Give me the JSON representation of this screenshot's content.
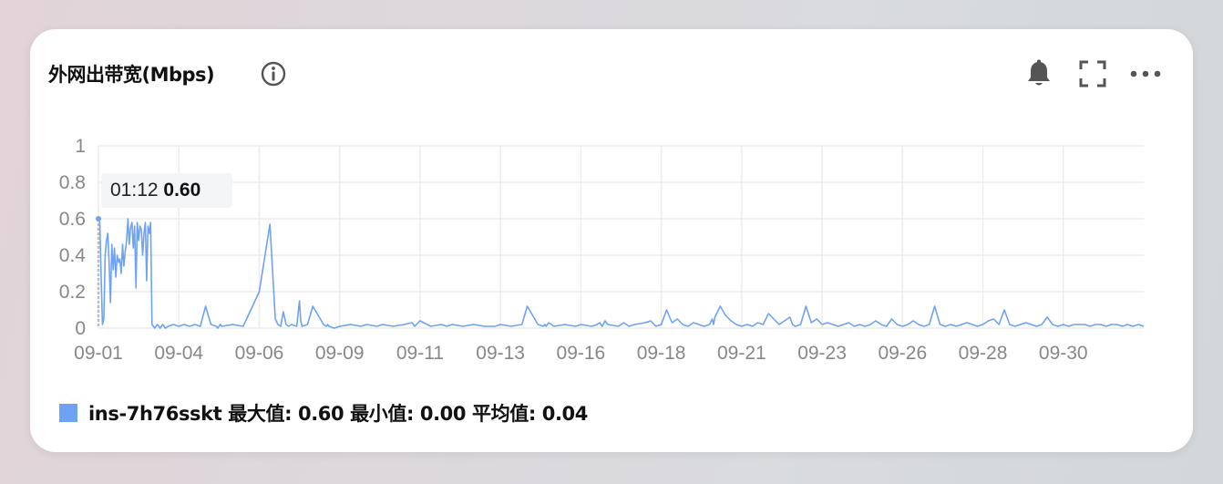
{
  "panel": {
    "title": "外网出带宽(Mbps)"
  },
  "icons": {
    "info": "info-circle-icon",
    "bell": "bell-icon",
    "fullscreen": "fullscreen-icon",
    "more": "more-icon"
  },
  "tooltip": {
    "time": "01:12",
    "value": "0.60"
  },
  "legend": {
    "name": "ins-7h76sskt",
    "max_label": "最大值:",
    "max": "0.60",
    "min_label": "最小值:",
    "min": "0.00",
    "avg_label": "平均值:",
    "avg": "0.04",
    "color": "#6ea3f4"
  },
  "chart_data": {
    "type": "line",
    "title": "外网出带宽(Mbps)",
    "xlabel": "",
    "ylabel": "",
    "ylim": [
      0,
      1
    ],
    "y_ticks": [
      "1",
      "0.8",
      "0.6",
      "0.4",
      "0.2",
      "0"
    ],
    "x_ticks": [
      "09-01",
      "09-04",
      "09-06",
      "09-09",
      "09-11",
      "09-13",
      "09-16",
      "09-18",
      "09-21",
      "09-23",
      "09-26",
      "09-28",
      "09-30"
    ],
    "grid": true,
    "legend_position": "bottom-left",
    "series": [
      {
        "name": "ins-7h76sskt",
        "color": "#6ea3f4",
        "x_days": [
          0.0,
          0.05,
          0.1,
          0.15,
          0.2,
          0.25,
          0.3,
          0.35,
          0.4,
          0.45,
          0.5,
          0.55,
          0.6,
          0.65,
          0.7,
          0.75,
          0.8,
          0.85,
          0.9,
          0.95,
          1.0,
          1.05,
          1.1,
          1.15,
          1.2,
          1.25,
          1.3,
          1.35,
          1.4,
          1.45,
          1.5,
          1.55,
          1.6,
          1.65,
          1.7,
          1.75,
          1.8,
          1.85,
          1.9,
          1.95,
          2.0,
          2.05,
          2.1,
          2.15,
          2.2,
          2.25,
          2.3,
          2.35,
          2.4,
          2.45,
          2.5,
          2.6,
          2.8,
          3.0,
          3.2,
          3.4,
          3.6,
          3.8,
          4.0,
          4.2,
          4.4,
          4.45,
          4.5,
          4.55,
          4.6,
          5.0,
          5.4,
          6.0,
          6.4,
          6.6,
          6.7,
          6.8,
          6.9,
          7.0,
          7.1,
          7.2,
          7.4,
          7.5,
          7.55,
          7.6,
          7.8,
          8.0,
          8.4,
          8.5,
          8.55,
          8.6,
          8.8,
          9.0,
          9.4,
          9.8,
          10.0,
          10.4,
          10.6,
          11.0,
          11.4,
          11.7,
          11.75,
          11.8,
          12.0,
          12.4,
          12.8,
          13.0,
          13.2,
          13.6,
          14.0,
          14.4,
          14.8,
          15.0,
          15.4,
          15.8,
          16.0,
          16.4,
          16.6,
          16.65,
          16.7,
          16.8,
          16.9,
          17.0,
          17.4,
          17.8,
          18.0,
          18.4,
          18.6,
          18.7,
          18.75,
          18.8,
          18.9,
          19.0,
          19.4,
          19.6,
          19.7,
          19.8,
          20.0,
          20.4,
          20.6,
          20.8,
          21.0,
          21.2,
          21.4,
          21.6,
          21.8,
          22.0,
          22.2,
          22.4,
          22.6,
          22.8,
          22.9,
          22.95,
          23.0,
          23.2,
          23.4,
          23.6,
          23.8,
          24.0,
          24.2,
          24.4,
          24.5,
          24.6,
          24.8,
          25.0,
          25.4,
          25.6,
          25.8,
          25.9,
          26.0,
          26.2,
          26.4,
          26.6,
          26.8,
          27.0,
          27.2,
          27.4,
          27.6,
          27.8,
          28.0,
          28.2,
          28.4,
          28.6,
          28.8,
          29.0,
          29.2,
          29.4,
          29.6,
          29.8,
          30.0,
          30.2,
          30.4,
          30.6,
          30.8,
          31.0,
          31.2,
          31.4,
          31.6,
          31.8,
          32.0,
          32.2,
          32.4,
          32.6,
          32.8,
          33.0,
          33.2,
          33.4,
          33.6,
          33.8,
          34.0,
          34.2,
          34.4,
          34.6,
          34.8,
          35.0,
          35.2,
          35.4,
          35.6,
          35.8,
          36.0,
          36.2,
          36.4,
          36.6,
          36.8,
          37.0,
          37.2,
          37.4,
          37.6,
          37.8,
          38.0,
          38.2,
          38.4,
          38.6,
          38.8,
          39.0
        ],
        "values": [
          0.6,
          0.58,
          0.3,
          0.02,
          0.05,
          0.4,
          0.48,
          0.52,
          0.35,
          0.14,
          0.46,
          0.32,
          0.44,
          0.28,
          0.4,
          0.36,
          0.38,
          0.3,
          0.46,
          0.34,
          0.42,
          0.48,
          0.6,
          0.46,
          0.55,
          0.58,
          0.44,
          0.56,
          0.22,
          0.58,
          0.48,
          0.56,
          0.54,
          0.4,
          0.52,
          0.58,
          0.26,
          0.56,
          0.52,
          0.58,
          0.02,
          0.01,
          0.0,
          0.01,
          0.02,
          0.01,
          0.0,
          0.01,
          0.02,
          0.01,
          0.0,
          0.01,
          0.02,
          0.01,
          0.02,
          0.01,
          0.02,
          0.01,
          0.12,
          0.02,
          0.01,
          0.0,
          0.01,
          0.02,
          0.01,
          0.02,
          0.01,
          0.2,
          0.57,
          0.05,
          0.02,
          0.01,
          0.09,
          0.02,
          0.01,
          0.02,
          0.01,
          0.15,
          0.04,
          0.01,
          0.02,
          0.12,
          0.02,
          0.01,
          0.02,
          0.01,
          0.0,
          0.01,
          0.02,
          0.01,
          0.02,
          0.01,
          0.02,
          0.01,
          0.02,
          0.03,
          0.02,
          0.01,
          0.04,
          0.01,
          0.02,
          0.01,
          0.02,
          0.01,
          0.02,
          0.01,
          0.01,
          0.02,
          0.01,
          0.02,
          0.12,
          0.02,
          0.01,
          0.02,
          0.01,
          0.03,
          0.02,
          0.01,
          0.02,
          0.01,
          0.02,
          0.01,
          0.02,
          0.03,
          0.02,
          0.01,
          0.04,
          0.02,
          0.01,
          0.03,
          0.02,
          0.01,
          0.02,
          0.03,
          0.04,
          0.01,
          0.02,
          0.1,
          0.03,
          0.05,
          0.02,
          0.01,
          0.03,
          0.02,
          0.01,
          0.02,
          0.05,
          0.02,
          0.06,
          0.12,
          0.07,
          0.04,
          0.02,
          0.01,
          0.02,
          0.01,
          0.02,
          0.03,
          0.02,
          0.08,
          0.02,
          0.04,
          0.06,
          0.02,
          0.01,
          0.02,
          0.12,
          0.03,
          0.05,
          0.02,
          0.03,
          0.02,
          0.01,
          0.02,
          0.03,
          0.01,
          0.02,
          0.01,
          0.02,
          0.04,
          0.02,
          0.01,
          0.05,
          0.02,
          0.01,
          0.02,
          0.04,
          0.02,
          0.01,
          0.02,
          0.12,
          0.02,
          0.01,
          0.02,
          0.01,
          0.02,
          0.03,
          0.02,
          0.01,
          0.02,
          0.04,
          0.05,
          0.02,
          0.1,
          0.02,
          0.01,
          0.02,
          0.03,
          0.02,
          0.01,
          0.02,
          0.06,
          0.02,
          0.01,
          0.02,
          0.01,
          0.02,
          0.02,
          0.02,
          0.01,
          0.02,
          0.02,
          0.01,
          0.02,
          0.02,
          0.01,
          0.02,
          0.01,
          0.02,
          0.01,
          0.02,
          0.02,
          0.01,
          0.02,
          0.02,
          0.01,
          0.02
        ]
      }
    ]
  }
}
